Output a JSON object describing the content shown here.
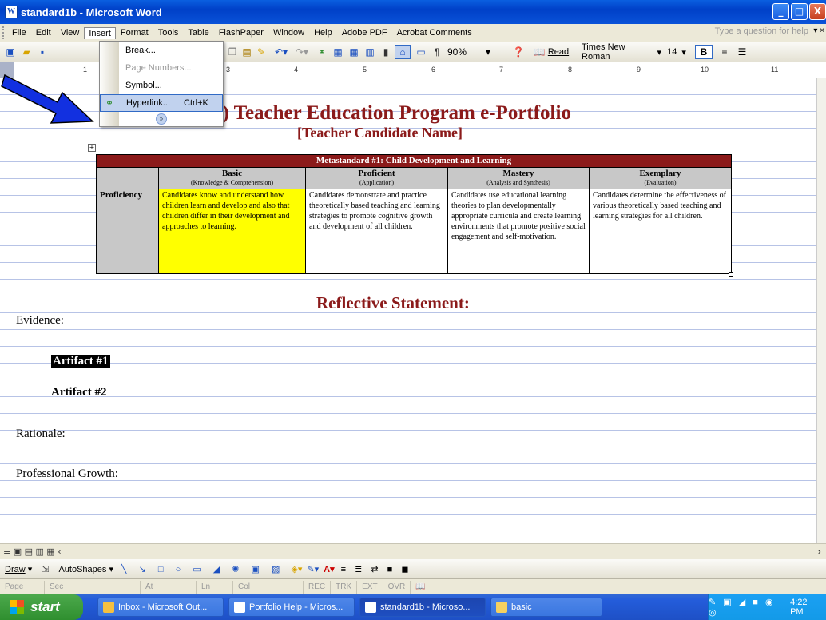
{
  "window": {
    "title": "standard1b - Microsoft Word",
    "min": "_",
    "max": "□",
    "close": "X"
  },
  "menubar": {
    "items": [
      "File",
      "Edit",
      "View",
      "Insert",
      "Format",
      "Tools",
      "Table",
      "FlashPaper",
      "Window",
      "Help",
      "Adobe PDF",
      "Acrobat Comments"
    ],
    "ask_placeholder": "Type a question for help"
  },
  "toolbar": {
    "zoom": "90%",
    "read_label": "Read",
    "font_name": "Times New Roman",
    "font_size": "14",
    "bold": "B"
  },
  "insert_menu": {
    "items": [
      {
        "label": "Break...",
        "shortcut": "",
        "disabled": false
      },
      {
        "label": "Page Numbers...",
        "shortcut": "",
        "disabled": true
      },
      {
        "label": "Symbol...",
        "shortcut": "",
        "disabled": false
      },
      {
        "label": "Hyperlink...",
        "shortcut": "Ctrl+K",
        "disabled": false,
        "highlighted": true
      }
    ],
    "expand": "»"
  },
  "ruler": {
    "marks": [
      "1",
      "2",
      "3",
      "4",
      "5",
      "6",
      "7",
      "8",
      "9",
      "10",
      "11"
    ]
  },
  "document": {
    "title": "ry (K-6) Teacher Education Program e-Portfolio",
    "subtitle": "[Teacher Candidate Name]",
    "table": {
      "header": "Metastandard #1: Child Development and Learning",
      "columns": [
        {
          "name": "Basic",
          "sub": "(Knowledge & Comprehension)"
        },
        {
          "name": "Proficient",
          "sub": "(Application)"
        },
        {
          "name": "Mastery",
          "sub": "(Analysis and Synthesis)"
        },
        {
          "name": "Exemplary",
          "sub": "(Evaluation)"
        }
      ],
      "row_label": "Proficiency",
      "cells": [
        "Candidates know and understand how children learn and develop and also that children differ in their development and approaches to learning.",
        "Candidates demonstrate and practice theoretically based teaching and learning strategies to promote cognitive growth and development of all children.",
        "Candidates use educational learning theories to plan developmentally appropriate curricula and create learning environments that promote positive social engagement and self-motivation.",
        "Candidates determine the effectiveness of various theoretically based teaching and learning strategies for all children."
      ]
    },
    "reflective": "Reflective Statement:",
    "evidence": "Evidence:",
    "artifact1": "Artifact #1",
    "artifact2": "Artifact #2",
    "rationale": "Rationale:",
    "growth": "Professional Growth:"
  },
  "drawbar": {
    "draw": "Draw",
    "autoshapes": "AutoShapes"
  },
  "statusbar": {
    "items": [
      "Page",
      "Sec",
      "At",
      "Ln",
      "Col",
      "REC",
      "TRK",
      "EXT",
      "OVR"
    ]
  },
  "taskbar": {
    "start": "start",
    "tasks": [
      "Inbox - Microsoft Out...",
      "Portfolio Help - Micros...",
      "standard1b - Microso...",
      "basic"
    ],
    "clock": "4:22 PM"
  }
}
